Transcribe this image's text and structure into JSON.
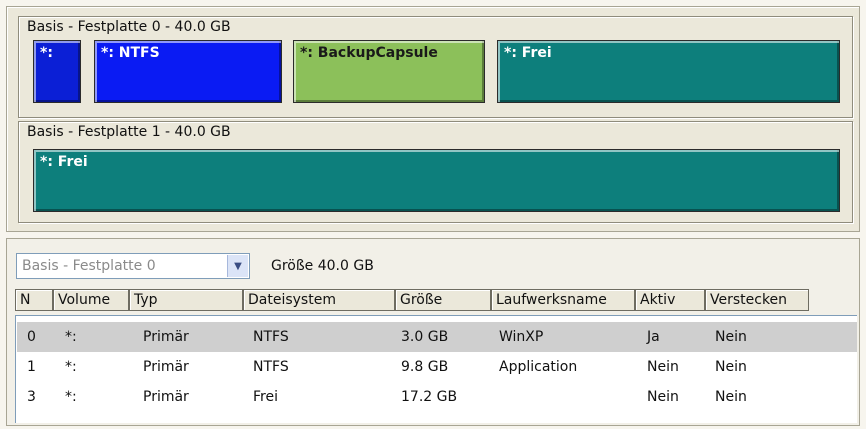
{
  "disks": [
    {
      "title": "Basis -  Festplatte 0 - 40.0 GB",
      "partitions": [
        {
          "label": "*:",
          "color": "#0b1fd6",
          "text_color": "#ffffff"
        },
        {
          "label": "*: NTFS",
          "color": "#0a1bf3",
          "text_color": "#ffffff"
        },
        {
          "label": "*: BackupCapsule",
          "color": "#8cc05a",
          "text_color": "#1a1a1a"
        },
        {
          "label": "*: Frei",
          "color": "#0d7f7c",
          "text_color": "#ffffff"
        }
      ]
    },
    {
      "title": "Basis -  Festplatte 1 - 40.0 GB",
      "partitions": [
        {
          "label": "*: Frei",
          "color": "#0d7f7c",
          "text_color": "#ffffff"
        }
      ]
    }
  ],
  "disk_select": {
    "value": "Basis -  Festplatte 0"
  },
  "size_label": "Größe 40.0 GB",
  "table": {
    "columns": [
      "N",
      "Volume",
      "Typ",
      "Dateisystem",
      "Größe",
      "Laufwerksname",
      "Aktiv",
      "Verstecken"
    ],
    "rows": [
      {
        "n": "0",
        "volume": "*:",
        "typ": "Primär",
        "dateisystem": "NTFS",
        "groesse": "3.0 GB",
        "laufwerksname": "WinXP",
        "aktiv": "Ja",
        "verstecken": "Nein"
      },
      {
        "n": "1",
        "volume": "*:",
        "typ": "Primär",
        "dateisystem": "NTFS",
        "groesse": "9.8 GB",
        "laufwerksname": "Application",
        "aktiv": "Nein",
        "verstecken": "Nein"
      },
      {
        "n": "3",
        "volume": "*:",
        "typ": "Primär",
        "dateisystem": "Frei",
        "groesse": "17.2 GB",
        "laufwerksname": "",
        "aktiv": "Nein",
        "verstecken": "Nein"
      }
    ]
  },
  "icons": {
    "dropdown": "chevron-down-icon"
  }
}
